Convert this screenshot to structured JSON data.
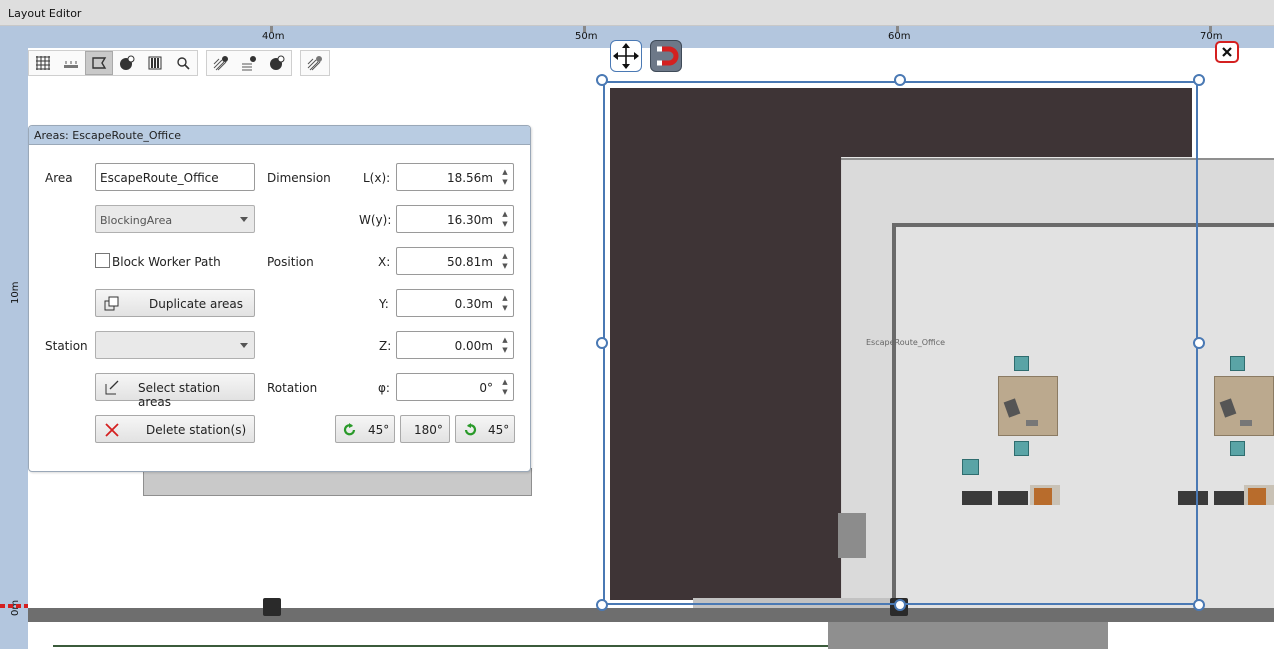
{
  "window": {
    "title": "Layout Editor"
  },
  "ruler": {
    "top_labels": [
      "40m",
      "50m",
      "60m",
      "70m"
    ],
    "left_labels": [
      "10m",
      "0m"
    ]
  },
  "toolbar": {
    "group1": [
      "grid-icon",
      "ruler-icon",
      "select-area-icon",
      "add-station-icon",
      "rack-icon",
      "zoom-icon"
    ],
    "group2": [
      "hatch-add-icon",
      "conveyor-add-icon",
      "station-add-icon"
    ],
    "group3": [
      "hatch-edit-icon"
    ]
  },
  "panel": {
    "title": "Areas: EscapeRoute_Office",
    "area_label": "Area",
    "area_name": "EscapeRoute_Office",
    "area_type": "BlockingArea",
    "block_worker_path": "Block Worker Path",
    "duplicate_label": "Duplicate areas",
    "station_label": "Station",
    "station_value": "",
    "select_station_label": "Select station areas",
    "delete_label": "Delete station(s)",
    "dimension_label": "Dimension",
    "position_label": "Position",
    "rotation_label": "Rotation",
    "lx_label": "L(x):",
    "lx_value": "18.56m",
    "wy_label": "W(y):",
    "wy_value": "16.30m",
    "x_label": "X:",
    "x_value": "50.81m",
    "y_label": "Y:",
    "y_value": "0.30m",
    "z_label": "Z:",
    "z_value": "0.00m",
    "phi_label": "φ:",
    "phi_value": "0°",
    "rot_ccw_label": "45°",
    "rot_180_label": "180°",
    "rot_cw_label": "45°"
  },
  "canvas": {
    "area_caption": "EscapeRoute_Office"
  },
  "colors": {
    "accent": "#4a79b4",
    "ruler": "#b3c6de",
    "dark_block": "#3e3436",
    "close": "#d42020"
  }
}
